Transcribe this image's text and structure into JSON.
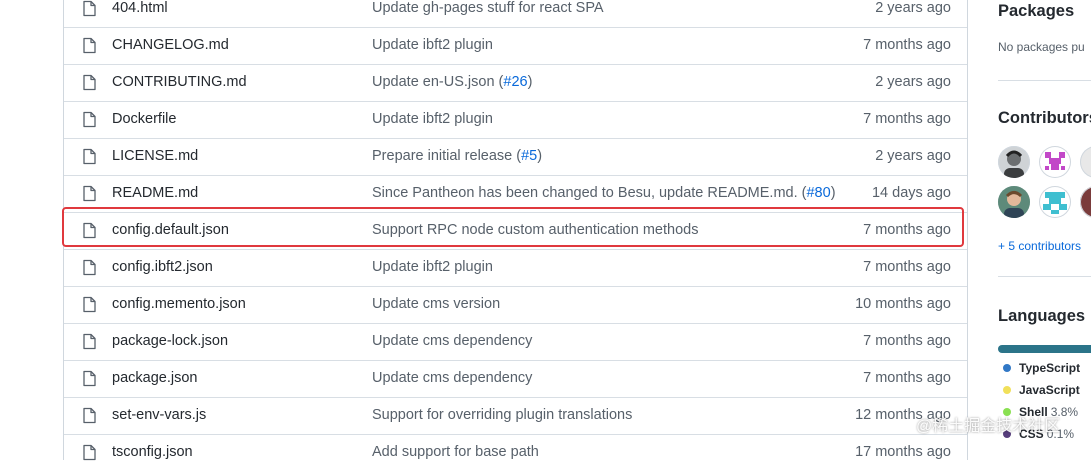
{
  "files": [
    {
      "name": "404.html",
      "message": "Update gh-pages stuff for react SPA",
      "age": "2 years ago"
    },
    {
      "name": "CHANGELOG.md",
      "message": "Update ibft2 plugin",
      "age": "7 months ago"
    },
    {
      "name": "CONTRIBUTING.md",
      "message": "Update en-US.json (",
      "message_link": "#26",
      "message_suffix": ")",
      "age": "2 years ago"
    },
    {
      "name": "Dockerfile",
      "message": "Update ibft2 plugin",
      "age": "7 months ago"
    },
    {
      "name": "LICENSE.md",
      "message": "Prepare initial release (",
      "message_link": "#5",
      "message_suffix": ")",
      "age": "2 years ago"
    },
    {
      "name": "README.md",
      "message": "Since Pantheon has been changed to Besu, update README.md. (",
      "message_link": "#80",
      "message_suffix": ")",
      "age": "14 days ago"
    },
    {
      "name": "config.default.json",
      "message": "Support RPC node custom authentication methods",
      "age": "7 months ago",
      "highlighted": true
    },
    {
      "name": "config.ibft2.json",
      "message": "Update ibft2 plugin",
      "age": "7 months ago"
    },
    {
      "name": "config.memento.json",
      "message": "Update cms version",
      "age": "10 months ago"
    },
    {
      "name": "package-lock.json",
      "message": "Update cms dependency",
      "age": "7 months ago"
    },
    {
      "name": "package.json",
      "message": "Update cms dependency",
      "age": "7 months ago"
    },
    {
      "name": "set-env-vars.js",
      "message": "Support for overriding plugin translations",
      "age": "12 months ago"
    },
    {
      "name": "tsconfig.json",
      "message": "Add support for base path",
      "age": "17 months ago"
    }
  ],
  "sidebar": {
    "packages_title": "Packages",
    "packages_text": "No packages pu",
    "contributors_title": "Contributors",
    "contributors_more": "+ 5 contributors",
    "languages_title": "Languages",
    "languages": [
      {
        "name": "TypeScript",
        "percent": "",
        "color": "#3178c6",
        "name_display": "TypeScript"
      },
      {
        "name": "JavaScript",
        "percent": "",
        "color": "#f1e05a",
        "name_display": "JavaScript"
      },
      {
        "name": "Shell",
        "percent": "3.8%",
        "color": "#89e051",
        "name_display": "Shell"
      },
      {
        "name": "CSS",
        "percent": "0.1%",
        "color": "#563d7c",
        "name_display": "CSS"
      }
    ]
  },
  "watermark": "@稀土掘金技术社区",
  "colors": {
    "highlight": "#e0393e",
    "link": "#0969da",
    "muted": "#57606a"
  }
}
